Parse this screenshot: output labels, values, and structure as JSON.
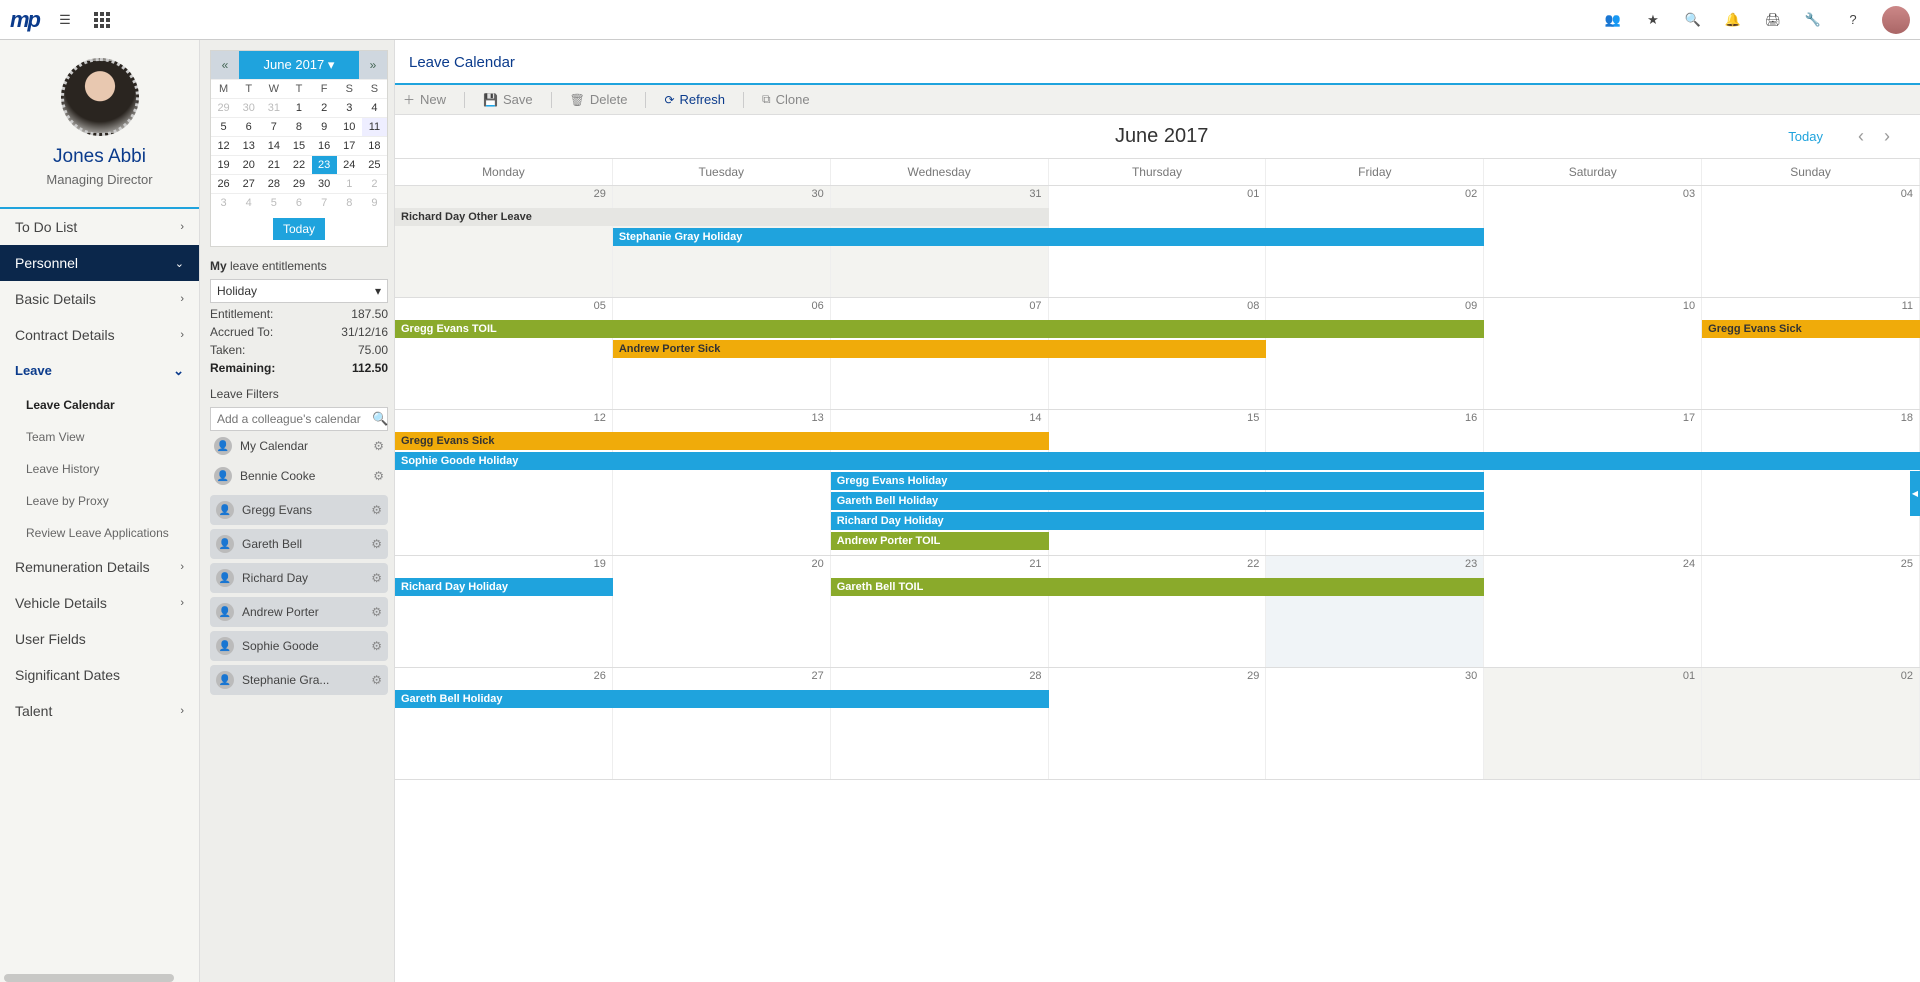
{
  "topbar": {
    "logo": "mp"
  },
  "profile": {
    "name": "Jones Abbi",
    "title": "Managing Director"
  },
  "nav": {
    "todolist": "To Do List",
    "personnel": "Personnel",
    "basic": "Basic Details",
    "contract": "Contract Details",
    "leave": "Leave",
    "leave_children": {
      "calendar": "Leave Calendar",
      "team": "Team View",
      "history": "Leave History",
      "proxy": "Leave by Proxy",
      "review": "Review Leave Applications"
    },
    "remuneration": "Remuneration Details",
    "vehicle": "Vehicle Details",
    "userfields": "User Fields",
    "sigdates": "Significant Dates",
    "talent": "Talent"
  },
  "minical": {
    "month_label": "June 2017",
    "today_btn": "Today",
    "dow": [
      "M",
      "T",
      "W",
      "T",
      "F",
      "S",
      "S"
    ],
    "rows": [
      [
        {
          "d": "29",
          "dim": true
        },
        {
          "d": "30",
          "dim": true
        },
        {
          "d": "31",
          "dim": true
        },
        {
          "d": "1"
        },
        {
          "d": "2"
        },
        {
          "d": "3"
        },
        {
          "d": "4"
        }
      ],
      [
        {
          "d": "5"
        },
        {
          "d": "6"
        },
        {
          "d": "7"
        },
        {
          "d": "8"
        },
        {
          "d": "9"
        },
        {
          "d": "10"
        },
        {
          "d": "11",
          "highlight": true
        }
      ],
      [
        {
          "d": "12"
        },
        {
          "d": "13"
        },
        {
          "d": "14"
        },
        {
          "d": "15"
        },
        {
          "d": "16"
        },
        {
          "d": "17"
        },
        {
          "d": "18"
        }
      ],
      [
        {
          "d": "19"
        },
        {
          "d": "20"
        },
        {
          "d": "21"
        },
        {
          "d": "22"
        },
        {
          "d": "23",
          "sel": true
        },
        {
          "d": "24"
        },
        {
          "d": "25"
        }
      ],
      [
        {
          "d": "26"
        },
        {
          "d": "27"
        },
        {
          "d": "28"
        },
        {
          "d": "29"
        },
        {
          "d": "30"
        },
        {
          "d": "1",
          "dim": true
        },
        {
          "d": "2",
          "dim": true
        }
      ],
      [
        {
          "d": "3",
          "dim": true
        },
        {
          "d": "4",
          "dim": true
        },
        {
          "d": "5",
          "dim": true
        },
        {
          "d": "6",
          "dim": true
        },
        {
          "d": "7",
          "dim": true
        },
        {
          "d": "8",
          "dim": true
        },
        {
          "d": "9",
          "dim": true
        }
      ]
    ]
  },
  "entitlements": {
    "heading_bold": "My",
    "heading_rest": " leave entitlements",
    "dropdown_value": "Holiday",
    "rows": [
      {
        "k": "Entitlement:",
        "v": "187.50"
      },
      {
        "k": "Accrued To:",
        "v": "31/12/16"
      },
      {
        "k": "Taken:",
        "v": "75.00"
      },
      {
        "k": "Remaining:",
        "v": "112.50",
        "bold": true
      }
    ]
  },
  "filters": {
    "heading": "Leave Filters",
    "placeholder": "Add a colleague's calendar",
    "mine": "My Calendar"
  },
  "people": [
    "Bennie Cooke",
    "Gregg Evans",
    "Gareth Bell",
    "Richard Day",
    "Andrew Porter",
    "Sophie Goode",
    "Stephanie Gra..."
  ],
  "page": {
    "title": "Leave Calendar"
  },
  "toolbar": {
    "new": "New",
    "save": "Save",
    "delete": "Delete",
    "refresh": "Refresh",
    "clone": "Clone"
  },
  "calendar": {
    "month_title": "June 2017",
    "today": "Today",
    "dow": [
      "Monday",
      "Tuesday",
      "Wednesday",
      "Thursday",
      "Friday",
      "Saturday",
      "Sunday"
    ],
    "weeks": [
      {
        "days": [
          {
            "n": "29",
            "faded": true
          },
          {
            "n": "30",
            "faded": true
          },
          {
            "n": "31",
            "faded": true
          },
          {
            "n": "01"
          },
          {
            "n": "02"
          },
          {
            "n": "03"
          },
          {
            "n": "04"
          }
        ],
        "bars": [
          {
            "label": "Richard Day Other Leave",
            "type": "other",
            "startCol": 1,
            "endCol": 3,
            "row": 0
          },
          {
            "label": "Stephanie Gray Holiday",
            "type": "holiday",
            "startCol": 2,
            "endCol": 5,
            "row": 1
          }
        ]
      },
      {
        "days": [
          {
            "n": "05"
          },
          {
            "n": "06"
          },
          {
            "n": "07"
          },
          {
            "n": "08"
          },
          {
            "n": "09"
          },
          {
            "n": "10"
          },
          {
            "n": "11"
          }
        ],
        "bars": [
          {
            "label": "Gregg Evans TOIL",
            "type": "toil",
            "startCol": 1,
            "endCol": 5,
            "row": 0
          },
          {
            "label": "Gregg Evans Sick",
            "type": "sick",
            "startCol": 7,
            "endCol": 7,
            "row": 0
          },
          {
            "label": "Andrew Porter Sick",
            "type": "sick",
            "startCol": 2,
            "endCol": 4,
            "row": 1
          }
        ]
      },
      {
        "days": [
          {
            "n": "12"
          },
          {
            "n": "13"
          },
          {
            "n": "14"
          },
          {
            "n": "15"
          },
          {
            "n": "16"
          },
          {
            "n": "17"
          },
          {
            "n": "18"
          }
        ],
        "bars": [
          {
            "label": "Gregg Evans Sick",
            "type": "sick",
            "startCol": 1,
            "endCol": 3,
            "row": 0
          },
          {
            "label": "Sophie Goode Holiday",
            "type": "holiday",
            "startCol": 1,
            "endCol": 7,
            "row": 1
          },
          {
            "label": "Gregg Evans Holiday",
            "type": "holiday",
            "startCol": 3,
            "endCol": 5,
            "row": 2
          },
          {
            "label": "Gareth Bell Holiday",
            "type": "holiday",
            "startCol": 3,
            "endCol": 5,
            "row": 3
          },
          {
            "label": "Richard Day Holiday",
            "type": "holiday",
            "startCol": 3,
            "endCol": 5,
            "row": 4
          },
          {
            "label": "Andrew Porter TOIL",
            "type": "toil",
            "startCol": 3,
            "endCol": 3,
            "row": 5
          }
        ]
      },
      {
        "days": [
          {
            "n": "19"
          },
          {
            "n": "20"
          },
          {
            "n": "21"
          },
          {
            "n": "22"
          },
          {
            "n": "23",
            "highlight": true
          },
          {
            "n": "24"
          },
          {
            "n": "25"
          }
        ],
        "bars": [
          {
            "label": "Richard Day Holiday",
            "type": "holiday",
            "startCol": 1,
            "endCol": 1,
            "row": 0
          },
          {
            "label": "Gareth Bell TOIL",
            "type": "toil",
            "startCol": 3,
            "endCol": 5,
            "row": 0
          }
        ]
      },
      {
        "days": [
          {
            "n": "26"
          },
          {
            "n": "27"
          },
          {
            "n": "28"
          },
          {
            "n": "29"
          },
          {
            "n": "30"
          },
          {
            "n": "01",
            "faded": true
          },
          {
            "n": "02",
            "faded": true
          }
        ],
        "bars": [
          {
            "label": "Gareth Bell Holiday",
            "type": "holiday",
            "startCol": 1,
            "endCol": 3,
            "row": 0
          }
        ]
      }
    ]
  }
}
